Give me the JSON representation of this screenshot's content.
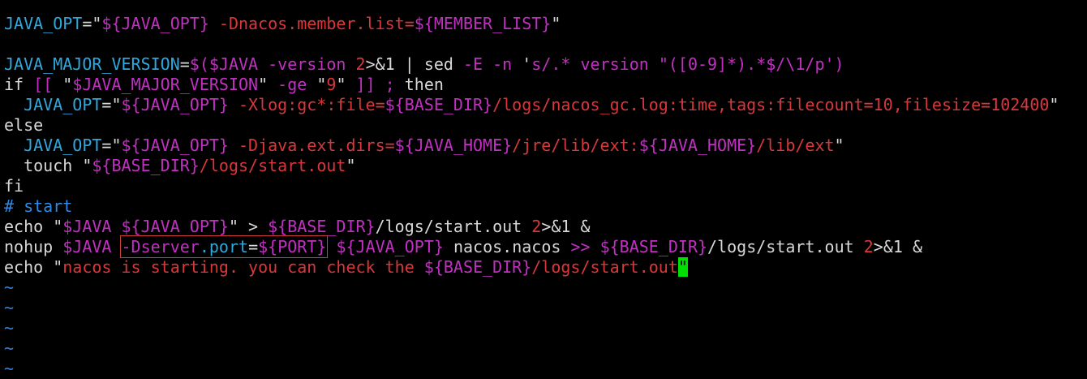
{
  "editor": {
    "lines": [
      {
        "tokens": [
          {
            "t": "JAVA_OPT",
            "c": "#2ea8de"
          },
          {
            "t": "=\"",
            "c": "#d8d8d8"
          },
          {
            "t": "${JAVA_OPT}",
            "c": "#c230c2"
          },
          {
            "t": " -Dnacos.member.list=",
            "c": "#d9373a"
          },
          {
            "t": "${MEMBER_LIST}",
            "c": "#c230c2"
          },
          {
            "t": "\"",
            "c": "#d8d8d8"
          }
        ]
      },
      {
        "tokens": []
      },
      {
        "tokens": [
          {
            "t": "JAVA_MAJOR_VERSION",
            "c": "#2ea8de"
          },
          {
            "t": "=",
            "c": "#d8d8d8"
          },
          {
            "t": "$($JAVA",
            "c": "#c230c2"
          },
          {
            "t": " -version ",
            "c": "#c230c2"
          },
          {
            "t": "2",
            "c": "#d9373a"
          },
          {
            "t": ">&1 | ",
            "c": "#d8d8d8"
          },
          {
            "t": "sed",
            "c": "#d8d8d8"
          },
          {
            "t": " -E -n ",
            "c": "#c230c2"
          },
          {
            "t": "'",
            "c": "#d8d8d8"
          },
          {
            "t": "s/.* version \"([0-9]*).*$/\\1/p",
            "c": "#c230c2"
          },
          {
            "t": "')",
            "c": "#c230c2"
          }
        ]
      },
      {
        "tokens": [
          {
            "t": "if",
            "c": "#d8d8d8"
          },
          {
            "t": " [[ ",
            "c": "#c230c2"
          },
          {
            "t": "\"",
            "c": "#d8d8d8"
          },
          {
            "t": "$JAVA_MAJOR_VERSION",
            "c": "#c230c2"
          },
          {
            "t": "\"",
            "c": "#d8d8d8"
          },
          {
            "t": " -ge ",
            "c": "#c230c2"
          },
          {
            "t": "\"",
            "c": "#d8d8d8"
          },
          {
            "t": "9",
            "c": "#d9373a"
          },
          {
            "t": "\"",
            "c": "#d8d8d8"
          },
          {
            "t": " ]] ; ",
            "c": "#c230c2"
          },
          {
            "t": "then",
            "c": "#d8d8d8"
          }
        ]
      },
      {
        "tokens": [
          {
            "t": "  JAVA_OPT",
            "c": "#2ea8de"
          },
          {
            "t": "=\"",
            "c": "#d8d8d8"
          },
          {
            "t": "${JAVA_OPT}",
            "c": "#c230c2"
          },
          {
            "t": " -Xlog:gc*:file=",
            "c": "#d9373a"
          },
          {
            "t": "${BASE_DIR}",
            "c": "#c230c2"
          },
          {
            "t": "/logs/nacos_gc.log:time,tags:filecount=10,filesize=102400",
            "c": "#d9373a"
          },
          {
            "t": "\"",
            "c": "#d8d8d8"
          }
        ]
      },
      {
        "tokens": [
          {
            "t": "else",
            "c": "#d8d8d8"
          }
        ]
      },
      {
        "tokens": [
          {
            "t": "  JAVA_OPT",
            "c": "#2ea8de"
          },
          {
            "t": "=\"",
            "c": "#d8d8d8"
          },
          {
            "t": "${JAVA_OPT}",
            "c": "#c230c2"
          },
          {
            "t": " -Djava.ext.dirs=",
            "c": "#d9373a"
          },
          {
            "t": "${JAVA_HOME}",
            "c": "#c230c2"
          },
          {
            "t": "/jre/lib/ext:",
            "c": "#d9373a"
          },
          {
            "t": "${JAVA_HOME}",
            "c": "#c230c2"
          },
          {
            "t": "/lib/ext",
            "c": "#d9373a"
          },
          {
            "t": "\"",
            "c": "#d8d8d8"
          }
        ]
      },
      {
        "tokens": [
          {
            "t": "  touch ",
            "c": "#d8d8d8"
          },
          {
            "t": "\"",
            "c": "#d8d8d8"
          },
          {
            "t": "${BASE_DIR}",
            "c": "#c230c2"
          },
          {
            "t": "/logs/start.out",
            "c": "#d9373a"
          },
          {
            "t": "\"",
            "c": "#d8d8d8"
          }
        ]
      },
      {
        "tokens": [
          {
            "t": "fi",
            "c": "#d8d8d8"
          }
        ]
      },
      {
        "tokens": [
          {
            "t": "# start",
            "c": "#2e8ae6"
          }
        ]
      },
      {
        "tokens": [
          {
            "t": "echo ",
            "c": "#d8d8d8"
          },
          {
            "t": "\"",
            "c": "#d8d8d8"
          },
          {
            "t": "$JAVA ${JAVA_OPT}",
            "c": "#c230c2"
          },
          {
            "t": "\"",
            "c": "#d8d8d8"
          },
          {
            "t": " > ",
            "c": "#d8d8d8"
          },
          {
            "t": "${BASE_DIR}",
            "c": "#c230c2"
          },
          {
            "t": "/logs/",
            "c": "#d8d8d8"
          },
          {
            "t": "start",
            "c": "#d8d8d8"
          },
          {
            "t": ".out ",
            "c": "#d8d8d8"
          },
          {
            "t": "2",
            "c": "#d9373a"
          },
          {
            "t": ">&1 &",
            "c": "#d8d8d8"
          }
        ]
      },
      {
        "tokens": [
          {
            "t": "nohup ",
            "c": "#d8d8d8"
          },
          {
            "t": "$JAVA",
            "c": "#c230c2"
          },
          {
            "t": " ",
            "c": "#d8d8d8"
          },
          {
            "t": "-Dserver.port=${PORT}",
            "c": "#c230c2",
            "box": true,
            "parts": [
              {
                "t": "-Dserver",
                "c": "#c230c2"
              },
              {
                "t": ".port",
                "c": "#2ea8de"
              },
              {
                "t": "=",
                "c": "#d8d8d8"
              },
              {
                "t": "${PORT}",
                "c": "#c230c2"
              }
            ]
          },
          {
            "t": " ",
            "c": "#d8d8d8"
          },
          {
            "t": "${JAVA_OPT}",
            "c": "#c230c2"
          },
          {
            "t": " nacos.nacos ",
            "c": "#d8d8d8"
          },
          {
            "t": ">>",
            "c": "#c230c2"
          },
          {
            "t": " ",
            "c": "#d8d8d8"
          },
          {
            "t": "${BASE_DIR}",
            "c": "#c230c2"
          },
          {
            "t": "/logs/",
            "c": "#d8d8d8"
          },
          {
            "t": "start",
            "c": "#d8d8d8"
          },
          {
            "t": ".out ",
            "c": "#d8d8d8"
          },
          {
            "t": "2",
            "c": "#d9373a"
          },
          {
            "t": ">&1 &",
            "c": "#d8d8d8"
          }
        ]
      },
      {
        "tokens": [
          {
            "t": "echo ",
            "c": "#d8d8d8"
          },
          {
            "t": "\"",
            "c": "#d8d8d8"
          },
          {
            "t": "nacos is starting. you can check the ",
            "c": "#d9373a"
          },
          {
            "t": "${BASE_DIR}",
            "c": "#c230c2"
          },
          {
            "t": "/logs/start.out",
            "c": "#d9373a"
          },
          {
            "t": "\"",
            "c": "#000000",
            "cursor": true
          }
        ]
      },
      {
        "tokens": [
          {
            "t": "~",
            "c": "#3b7fd4"
          }
        ]
      },
      {
        "tokens": [
          {
            "t": "~",
            "c": "#3b7fd4"
          }
        ]
      },
      {
        "tokens": [
          {
            "t": "~",
            "c": "#3b7fd4"
          }
        ]
      },
      {
        "tokens": [
          {
            "t": "~",
            "c": "#3b7fd4"
          }
        ]
      },
      {
        "tokens": [
          {
            "t": "~",
            "c": "#3b7fd4"
          }
        ]
      }
    ]
  }
}
